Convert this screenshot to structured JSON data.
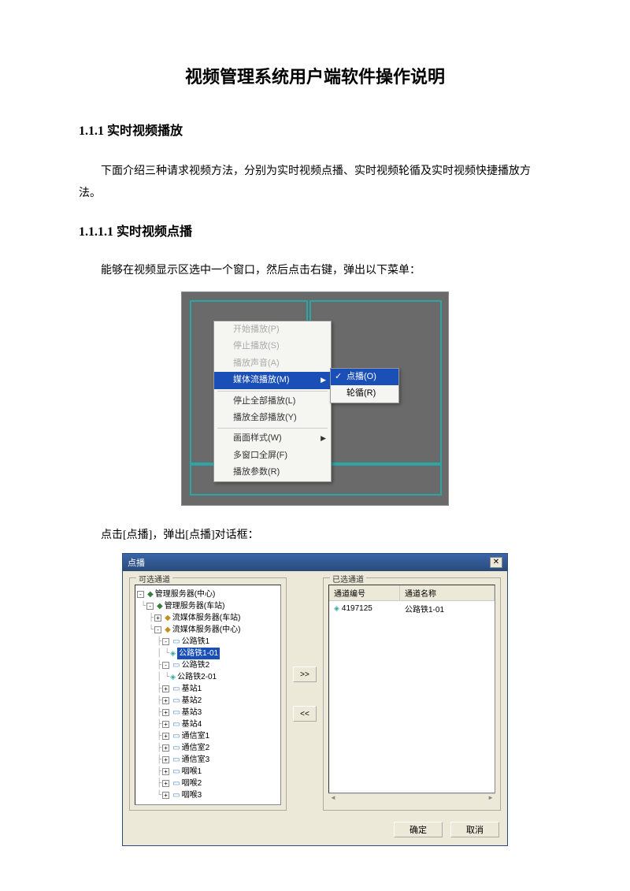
{
  "doc": {
    "title": "视频管理系统用户端软件操作说明",
    "h1": "1.1.1   实时视频播放",
    "para1": "下面介绍三种请求视频方法，分别为实时视频点播、实时视频轮循及实时视频快捷播放方法。",
    "h2": "1.1.1.1  实时视频点播",
    "caption1": "能够在视频显示区选中一个窗口，然后点击右键，弹出以下菜单：",
    "caption2": "点击[点播]，弹出[点播]对话框："
  },
  "menu": {
    "start_play": "开始播放(P)",
    "stop_play": "停止播放(S)",
    "play_sound": "播放声音(A)",
    "media_stream": "媒体流播放(M)",
    "stop_all": "停止全部播放(L)",
    "play_all": "播放全部播放(Y)",
    "style": "画面样式(W)",
    "fullscreen": "多窗口全屏(F)",
    "params": "播放参数(R)",
    "sub_vod": "点播(O)",
    "sub_rotate": "轮循(R)"
  },
  "dialog": {
    "title": "点播",
    "left_label": "可选通道",
    "right_label": "已选通道",
    "col_id": "通道编号",
    "col_name": "通道名称",
    "btn_add": ">>",
    "btn_remove": "<<",
    "btn_ok": "确定",
    "btn_cancel": "取消",
    "tree": {
      "n0": "管理服务器(中心)",
      "n1": "管理服务器(车站)",
      "n2": "流媒体服务器(车站)",
      "n3": "流媒体服务器(中心)",
      "n4": "公路铁1",
      "n5": "公路铁1-01",
      "n6": "公路铁2",
      "n7": "公路铁2-01",
      "n8": "基站1",
      "n9": "基站2",
      "n10": "基站3",
      "n11": "基站4",
      "n12": "通信室1",
      "n13": "通信室2",
      "n14": "通信室3",
      "n15": "咽喉1",
      "n16": "咽喉2",
      "n17": "咽喉3"
    },
    "selected": {
      "id": "4197125",
      "name": "公路铁1-01"
    }
  }
}
